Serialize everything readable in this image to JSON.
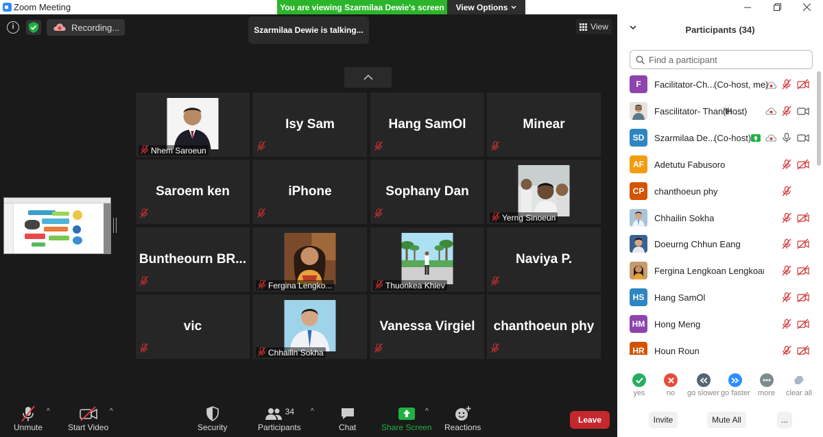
{
  "window": {
    "title": "Zoom Meeting"
  },
  "banner": {
    "viewing": "You are viewing Szarmilaa Dewie's screen",
    "view_options": "View Options"
  },
  "status": {
    "recording": "Recording..."
  },
  "talking": "Szarmilaa Dewie is talking...",
  "view_button": "View",
  "gallery": [
    {
      "name": "Nhem Saroeun",
      "type": "photo"
    },
    {
      "name": "Isy Sam",
      "type": "name"
    },
    {
      "name": "Hang SamOl",
      "type": "name"
    },
    {
      "name": "Minear",
      "type": "name"
    },
    {
      "name": "Saroem ken",
      "type": "name"
    },
    {
      "name": "iPhone",
      "type": "name"
    },
    {
      "name": "Sophany Dan",
      "type": "name"
    },
    {
      "name": "Yerng Sinoeun",
      "type": "photo"
    },
    {
      "name": "Buntheourn  BR...",
      "type": "name"
    },
    {
      "name": "Fergina Lengko...",
      "type": "photo"
    },
    {
      "name": "Thuonkea Khiev",
      "type": "photo"
    },
    {
      "name": "Naviya P.",
      "type": "name"
    },
    {
      "name": "vic",
      "type": "name"
    },
    {
      "name": "Chhailin Sokha",
      "type": "photo"
    },
    {
      "name": "Vanessa Virgiel",
      "type": "name"
    },
    {
      "name": "chanthoeun phy",
      "type": "name"
    }
  ],
  "toolbar": {
    "unmute": "Unmute",
    "start_video": "Start Video",
    "security": "Security",
    "participants": "Participants",
    "participants_count": "34",
    "chat": "Chat",
    "share_screen": "Share Screen",
    "reactions": "Reactions",
    "leave": "Leave"
  },
  "panel": {
    "title": "Participants (34)",
    "search_placeholder": "Find a participant",
    "participants": [
      {
        "initials": "F",
        "color": "#8e44ad",
        "name": "Facilitator-Ch...",
        "role": "(Co-host, me)",
        "cloud": true,
        "mic": "muted",
        "video": "off"
      },
      {
        "initials": "",
        "color": "#d8d0c8",
        "name": "Fascilitator- Thanith ...",
        "role": "(Host)",
        "cloud": true,
        "mic": "muted",
        "video": "on"
      },
      {
        "initials": "SD",
        "color": "#2e86c1",
        "name": "Szarmilaa De...",
        "role": "(Co-host)",
        "share": true,
        "cloud": true,
        "mic": "on",
        "video": "on"
      },
      {
        "initials": "AF",
        "color": "#f39c12",
        "name": "Adetutu Fabusoro",
        "role": "",
        "mic": "muted",
        "video": "off"
      },
      {
        "initials": "CP",
        "color": "#d35400",
        "name": "chanthoeun phy",
        "role": "",
        "mic": "muted",
        "video": "none"
      },
      {
        "initials": "",
        "color": "#a9c4d8",
        "name": "Chhailin Sokha",
        "role": "",
        "mic": "muted",
        "video": "off"
      },
      {
        "initials": "",
        "color": "#4a6fa5",
        "name": "Doeurng Chhun Eang",
        "role": "",
        "mic": "muted",
        "video": "off"
      },
      {
        "initials": "",
        "color": "#c69c6d",
        "name": "Fergina Lengkoan Lengkoan",
        "role": "",
        "mic": "muted",
        "video": "off"
      },
      {
        "initials": "HS",
        "color": "#2e86c1",
        "name": "Hang SamOl",
        "role": "",
        "mic": "muted",
        "video": "off"
      },
      {
        "initials": "HM",
        "color": "#8e44ad",
        "name": "Hong Meng",
        "role": "",
        "mic": "muted",
        "video": "off"
      },
      {
        "initials": "HR",
        "color": "#d35400",
        "name": "Houn Roun",
        "role": "",
        "mic": "muted",
        "video": "off"
      }
    ],
    "reactions": [
      {
        "label": "yes",
        "color": "#27ae60"
      },
      {
        "label": "no",
        "color": "#e74c3c"
      },
      {
        "label": "go slower",
        "color": "#566573"
      },
      {
        "label": "go faster",
        "color": "#2d8cff"
      },
      {
        "label": "more",
        "color": "#7f8c8d"
      },
      {
        "label": "clear all",
        "color": "#aab7c4"
      }
    ],
    "invite": "Invite",
    "mute_all": "Mute All",
    "more": "..."
  }
}
